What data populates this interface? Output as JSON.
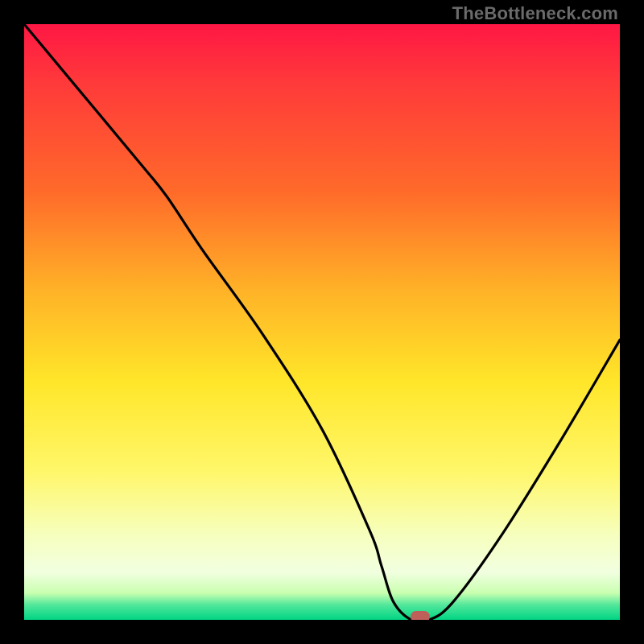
{
  "watermark": "TheBottleneck.com",
  "chart_data": {
    "type": "line",
    "title": "",
    "xlabel": "",
    "ylabel": "",
    "xlim": [
      0,
      100
    ],
    "ylim": [
      0,
      100
    ],
    "grid": false,
    "gradient_stops": [
      {
        "offset": 0.0,
        "color": "#ff1744"
      },
      {
        "offset": 0.1,
        "color": "#ff3a3a"
      },
      {
        "offset": 0.28,
        "color": "#ff6a2a"
      },
      {
        "offset": 0.45,
        "color": "#ffb327"
      },
      {
        "offset": 0.6,
        "color": "#ffe629"
      },
      {
        "offset": 0.75,
        "color": "#fff76a"
      },
      {
        "offset": 0.86,
        "color": "#f6ffbf"
      },
      {
        "offset": 0.92,
        "color": "#f2ffe0"
      },
      {
        "offset": 0.955,
        "color": "#c9ffb0"
      },
      {
        "offset": 0.975,
        "color": "#52e79b"
      },
      {
        "offset": 1.0,
        "color": "#00d584"
      }
    ],
    "series": [
      {
        "name": "bottleneck-curve",
        "x": [
          0,
          10,
          20,
          24,
          30,
          40,
          50,
          58,
          60,
          62,
          65,
          68,
          72,
          80,
          90,
          100
        ],
        "values": [
          100,
          88,
          76,
          71,
          62,
          48,
          32,
          15,
          9,
          3,
          0,
          0,
          3,
          14,
          30,
          47
        ]
      }
    ],
    "marker": {
      "x": 66.5,
      "y": 0.5
    }
  }
}
